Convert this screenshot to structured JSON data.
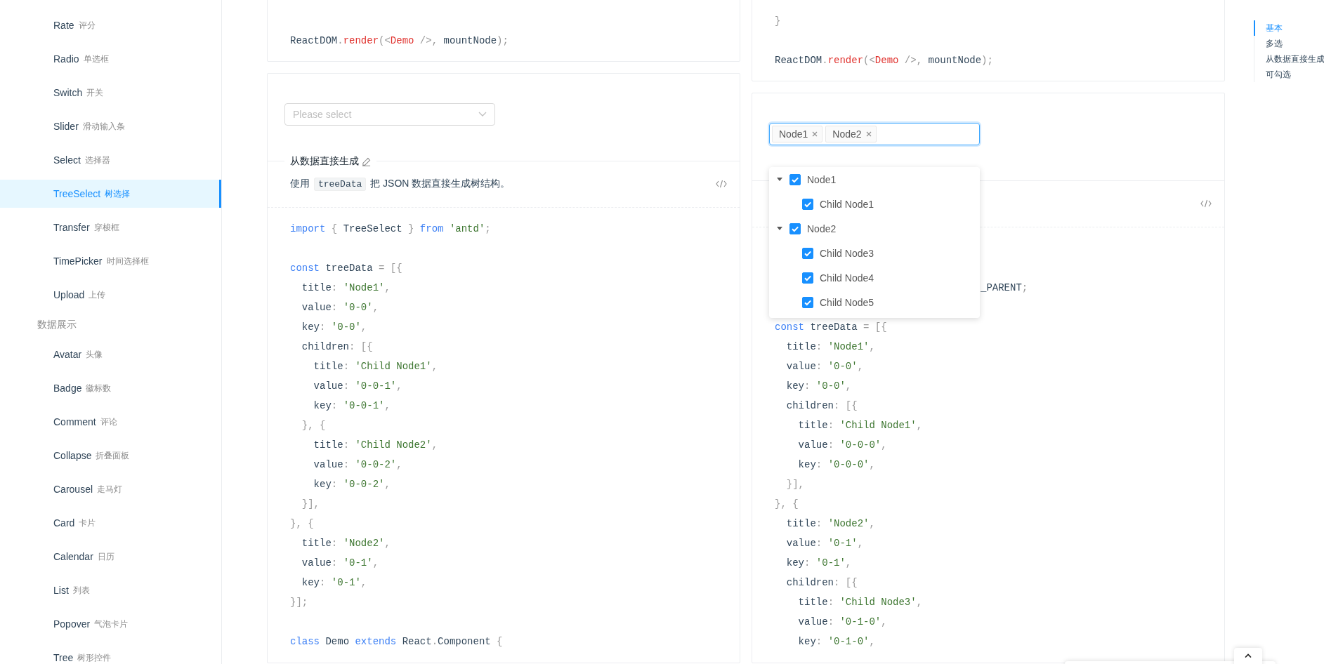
{
  "sidebar": {
    "items": [
      {
        "kind": "item",
        "label": "Rate",
        "sublabel": "评分",
        "selected": false
      },
      {
        "kind": "item",
        "label": "Radio",
        "sublabel": "单选框",
        "selected": false
      },
      {
        "kind": "item",
        "label": "Switch",
        "sublabel": "开关",
        "selected": false
      },
      {
        "kind": "item",
        "label": "Slider",
        "sublabel": "滑动输入条",
        "selected": false
      },
      {
        "kind": "item",
        "label": "Select",
        "sublabel": "选择器",
        "selected": false
      },
      {
        "kind": "item",
        "label": "TreeSelect",
        "sublabel": "树选择",
        "selected": true
      },
      {
        "kind": "item",
        "label": "Transfer",
        "sublabel": "穿梭框",
        "selected": false
      },
      {
        "kind": "item",
        "label": "TimePicker",
        "sublabel": "时间选择框",
        "selected": false
      },
      {
        "kind": "item",
        "label": "Upload",
        "sublabel": "上传",
        "selected": false
      },
      {
        "kind": "group",
        "label": "数据展示"
      },
      {
        "kind": "item",
        "label": "Avatar",
        "sublabel": "头像",
        "selected": false
      },
      {
        "kind": "item",
        "label": "Badge",
        "sublabel": "徽标数",
        "selected": false
      },
      {
        "kind": "item",
        "label": "Comment",
        "sublabel": "评论",
        "selected": false
      },
      {
        "kind": "item",
        "label": "Collapse",
        "sublabel": "折叠面板",
        "selected": false
      },
      {
        "kind": "item",
        "label": "Carousel",
        "sublabel": "走马灯",
        "selected": false
      },
      {
        "kind": "item",
        "label": "Card",
        "sublabel": "卡片",
        "selected": false
      },
      {
        "kind": "item",
        "label": "Calendar",
        "sublabel": "日历",
        "selected": false
      },
      {
        "kind": "item",
        "label": "List",
        "sublabel": "列表",
        "selected": false
      },
      {
        "kind": "item",
        "label": "Popover",
        "sublabel": "气泡卡片",
        "selected": false
      },
      {
        "kind": "item",
        "label": "Tree",
        "sublabel": "树形控件",
        "selected": false
      }
    ]
  },
  "left_column": {
    "top_code": {
      "lines": [
        {
          "kind": "blank"
        },
        {
          "kind": "blank"
        },
        {
          "kind": "code",
          "tokens": [
            {
              "kind": "plain",
              "text": "ReactDOM"
            },
            {
              "kind": "punct",
              "text": "."
            },
            {
              "kind": "func",
              "text": "render"
            },
            {
              "kind": "punct",
              "text": "(<"
            },
            {
              "kind": "func",
              "text": "Demo"
            },
            {
              "kind": "punct",
              "text": " />, "
            },
            {
              "kind": "plain",
              "text": "mountNode"
            },
            {
              "kind": "punct",
              "text": ");"
            }
          ]
        }
      ]
    },
    "demo": {
      "select": {
        "placeholder": "Please select"
      },
      "title": "从数据直接生成",
      "description": {
        "before": "使用",
        "code": "treeData",
        "after": "把 JSON 数据直接生成树结构。"
      },
      "code": {
        "lines": [
          {
            "kind": "code",
            "tokens": [
              {
                "kind": "keyword",
                "text": "import "
              },
              {
                "kind": "punct",
                "text": "{ "
              },
              {
                "kind": "plain",
                "text": "TreeSelect "
              },
              {
                "kind": "punct",
                "text": "} "
              },
              {
                "kind": "keyword",
                "text": "from "
              },
              {
                "kind": "string",
                "text": "'antd'"
              },
              {
                "kind": "punct",
                "text": ";"
              }
            ]
          },
          {
            "kind": "blank"
          },
          {
            "kind": "code",
            "tokens": [
              {
                "kind": "keyword",
                "text": "const "
              },
              {
                "kind": "plain",
                "text": "treeData "
              },
              {
                "kind": "punct",
                "text": "= [{"
              }
            ]
          },
          {
            "kind": "code",
            "tokens": [
              {
                "kind": "plain",
                "text": "  title"
              },
              {
                "kind": "punct",
                "text": ": "
              },
              {
                "kind": "string",
                "text": "'Node1'"
              },
              {
                "kind": "punct",
                "text": ","
              }
            ]
          },
          {
            "kind": "code",
            "tokens": [
              {
                "kind": "plain",
                "text": "  value"
              },
              {
                "kind": "punct",
                "text": ": "
              },
              {
                "kind": "string",
                "text": "'0-0'"
              },
              {
                "kind": "punct",
                "text": ","
              }
            ]
          },
          {
            "kind": "code",
            "tokens": [
              {
                "kind": "plain",
                "text": "  key"
              },
              {
                "kind": "punct",
                "text": ": "
              },
              {
                "kind": "string",
                "text": "'0-0'"
              },
              {
                "kind": "punct",
                "text": ","
              }
            ]
          },
          {
            "kind": "code",
            "tokens": [
              {
                "kind": "plain",
                "text": "  children"
              },
              {
                "kind": "punct",
                "text": ": [{"
              }
            ]
          },
          {
            "kind": "code",
            "tokens": [
              {
                "kind": "plain",
                "text": "    title"
              },
              {
                "kind": "punct",
                "text": ": "
              },
              {
                "kind": "string",
                "text": "'Child Node1'"
              },
              {
                "kind": "punct",
                "text": ","
              }
            ]
          },
          {
            "kind": "code",
            "tokens": [
              {
                "kind": "plain",
                "text": "    value"
              },
              {
                "kind": "punct",
                "text": ": "
              },
              {
                "kind": "string",
                "text": "'0-0-1'"
              },
              {
                "kind": "punct",
                "text": ","
              }
            ]
          },
          {
            "kind": "code",
            "tokens": [
              {
                "kind": "plain",
                "text": "    key"
              },
              {
                "kind": "punct",
                "text": ": "
              },
              {
                "kind": "string",
                "text": "'0-0-1'"
              },
              {
                "kind": "punct",
                "text": ","
              }
            ]
          },
          {
            "kind": "code",
            "tokens": [
              {
                "kind": "punct",
                "text": "  }, {"
              }
            ]
          },
          {
            "kind": "code",
            "tokens": [
              {
                "kind": "plain",
                "text": "    title"
              },
              {
                "kind": "punct",
                "text": ": "
              },
              {
                "kind": "string",
                "text": "'Child Node2'"
              },
              {
                "kind": "punct",
                "text": ","
              }
            ]
          },
          {
            "kind": "code",
            "tokens": [
              {
                "kind": "plain",
                "text": "    value"
              },
              {
                "kind": "punct",
                "text": ": "
              },
              {
                "kind": "string",
                "text": "'0-0-2'"
              },
              {
                "kind": "punct",
                "text": ","
              }
            ]
          },
          {
            "kind": "code",
            "tokens": [
              {
                "kind": "plain",
                "text": "    key"
              },
              {
                "kind": "punct",
                "text": ": "
              },
              {
                "kind": "string",
                "text": "'0-0-2'"
              },
              {
                "kind": "punct",
                "text": ","
              }
            ]
          },
          {
            "kind": "code",
            "tokens": [
              {
                "kind": "punct",
                "text": "  }],"
              }
            ]
          },
          {
            "kind": "code",
            "tokens": [
              {
                "kind": "punct",
                "text": "}, {"
              }
            ]
          },
          {
            "kind": "code",
            "tokens": [
              {
                "kind": "plain",
                "text": "  title"
              },
              {
                "kind": "punct",
                "text": ": "
              },
              {
                "kind": "string",
                "text": "'Node2'"
              },
              {
                "kind": "punct",
                "text": ","
              }
            ]
          },
          {
            "kind": "code",
            "tokens": [
              {
                "kind": "plain",
                "text": "  value"
              },
              {
                "kind": "punct",
                "text": ": "
              },
              {
                "kind": "string",
                "text": "'0-1'"
              },
              {
                "kind": "punct",
                "text": ","
              }
            ]
          },
          {
            "kind": "code",
            "tokens": [
              {
                "kind": "plain",
                "text": "  key"
              },
              {
                "kind": "punct",
                "text": ": "
              },
              {
                "kind": "string",
                "text": "'0-1'"
              },
              {
                "kind": "punct",
                "text": ","
              }
            ]
          },
          {
            "kind": "code",
            "tokens": [
              {
                "kind": "punct",
                "text": "}];"
              }
            ]
          },
          {
            "kind": "blank"
          },
          {
            "kind": "code",
            "tokens": [
              {
                "kind": "keyword",
                "text": "class "
              },
              {
                "kind": "plain",
                "text": "Demo "
              },
              {
                "kind": "keyword",
                "text": "extends "
              },
              {
                "kind": "plain",
                "text": "React"
              },
              {
                "kind": "punct",
                "text": "."
              },
              {
                "kind": "plain",
                "text": "Component "
              },
              {
                "kind": "punct",
                "text": "{"
              }
            ]
          }
        ]
      }
    }
  },
  "right_column": {
    "top_code": {
      "lines": [
        {
          "kind": "blank"
        },
        {
          "kind": "code",
          "tokens": [
            {
              "kind": "punct",
              "text": "}"
            }
          ]
        },
        {
          "kind": "blank"
        },
        {
          "kind": "code",
          "tokens": [
            {
              "kind": "plain",
              "text": "ReactDOM"
            },
            {
              "kind": "punct",
              "text": "."
            },
            {
              "kind": "func",
              "text": "render"
            },
            {
              "kind": "punct",
              "text": "(<"
            },
            {
              "kind": "func",
              "text": "Demo"
            },
            {
              "kind": "punct",
              "text": " />, "
            },
            {
              "kind": "plain",
              "text": "mountNode"
            },
            {
              "kind": "punct",
              "text": ");"
            }
          ]
        }
      ]
    },
    "demo": {
      "tags": [
        {
          "label": "Node1"
        },
        {
          "label": "Node2"
        }
      ],
      "tree": {
        "nodes": [
          {
            "label": "Node1",
            "checked": true,
            "expanded": true,
            "children": [
              {
                "label": "Child Node1",
                "checked": true
              }
            ]
          },
          {
            "label": "Node2",
            "checked": true,
            "expanded": true,
            "children": [
              {
                "label": "Child Node3",
                "checked": true
              },
              {
                "label": "Child Node4",
                "checked": true
              },
              {
                "label": "Child Node5",
                "checked": true
              }
            ]
          }
        ]
      },
      "code": {
        "lines": [
          {
            "kind": "code",
            "tokens": [
              {
                "kind": "plain",
                "text": "_PARENT"
              },
              {
                "kind": "punct",
                "text": ";"
              }
            ]
          },
          {
            "kind": "blank"
          },
          {
            "kind": "code",
            "tokens": [
              {
                "kind": "keyword",
                "text": "const "
              },
              {
                "kind": "plain",
                "text": "treeData "
              },
              {
                "kind": "punct",
                "text": "= [{"
              }
            ]
          },
          {
            "kind": "code",
            "tokens": [
              {
                "kind": "plain",
                "text": "  title"
              },
              {
                "kind": "punct",
                "text": ": "
              },
              {
                "kind": "string",
                "text": "'Node1'"
              },
              {
                "kind": "punct",
                "text": ","
              }
            ]
          },
          {
            "kind": "code",
            "tokens": [
              {
                "kind": "plain",
                "text": "  value"
              },
              {
                "kind": "punct",
                "text": ": "
              },
              {
                "kind": "string",
                "text": "'0-0'"
              },
              {
                "kind": "punct",
                "text": ","
              }
            ]
          },
          {
            "kind": "code",
            "tokens": [
              {
                "kind": "plain",
                "text": "  key"
              },
              {
                "kind": "punct",
                "text": ": "
              },
              {
                "kind": "string",
                "text": "'0-0'"
              },
              {
                "kind": "punct",
                "text": ","
              }
            ]
          },
          {
            "kind": "code",
            "tokens": [
              {
                "kind": "plain",
                "text": "  children"
              },
              {
                "kind": "punct",
                "text": ": [{"
              }
            ]
          },
          {
            "kind": "code",
            "tokens": [
              {
                "kind": "plain",
                "text": "    title"
              },
              {
                "kind": "punct",
                "text": ": "
              },
              {
                "kind": "string",
                "text": "'Child Node1'"
              },
              {
                "kind": "punct",
                "text": ","
              }
            ]
          },
          {
            "kind": "code",
            "tokens": [
              {
                "kind": "plain",
                "text": "    value"
              },
              {
                "kind": "punct",
                "text": ": "
              },
              {
                "kind": "string",
                "text": "'0-0-0'"
              },
              {
                "kind": "punct",
                "text": ","
              }
            ]
          },
          {
            "kind": "code",
            "tokens": [
              {
                "kind": "plain",
                "text": "    key"
              },
              {
                "kind": "punct",
                "text": ": "
              },
              {
                "kind": "string",
                "text": "'0-0-0'"
              },
              {
                "kind": "punct",
                "text": ","
              }
            ]
          },
          {
            "kind": "code",
            "tokens": [
              {
                "kind": "punct",
                "text": "  }],"
              }
            ]
          },
          {
            "kind": "code",
            "tokens": [
              {
                "kind": "punct",
                "text": "}, {"
              }
            ]
          },
          {
            "kind": "code",
            "tokens": [
              {
                "kind": "plain",
                "text": "  title"
              },
              {
                "kind": "punct",
                "text": ": "
              },
              {
                "kind": "string",
                "text": "'Node2'"
              },
              {
                "kind": "punct",
                "text": ","
              }
            ]
          },
          {
            "kind": "code",
            "tokens": [
              {
                "kind": "plain",
                "text": "  value"
              },
              {
                "kind": "punct",
                "text": ": "
              },
              {
                "kind": "string",
                "text": "'0-1'"
              },
              {
                "kind": "punct",
                "text": ","
              }
            ]
          },
          {
            "kind": "code",
            "tokens": [
              {
                "kind": "plain",
                "text": "  key"
              },
              {
                "kind": "punct",
                "text": ": "
              },
              {
                "kind": "string",
                "text": "'0-1'"
              },
              {
                "kind": "punct",
                "text": ","
              }
            ]
          },
          {
            "kind": "code",
            "tokens": [
              {
                "kind": "plain",
                "text": "  children"
              },
              {
                "kind": "punct",
                "text": ": [{"
              }
            ]
          },
          {
            "kind": "code",
            "tokens": [
              {
                "kind": "plain",
                "text": "    title"
              },
              {
                "kind": "punct",
                "text": ": "
              },
              {
                "kind": "string",
                "text": "'Child Node3'"
              },
              {
                "kind": "punct",
                "text": ","
              }
            ]
          },
          {
            "kind": "code",
            "tokens": [
              {
                "kind": "plain",
                "text": "    value"
              },
              {
                "kind": "punct",
                "text": ": "
              },
              {
                "kind": "string",
                "text": "'0-1-0'"
              },
              {
                "kind": "punct",
                "text": ","
              }
            ]
          },
          {
            "kind": "code",
            "tokens": [
              {
                "kind": "plain",
                "text": "    key"
              },
              {
                "kind": "punct",
                "text": ": "
              },
              {
                "kind": "string",
                "text": "'0-1-0'"
              },
              {
                "kind": "punct",
                "text": ","
              }
            ]
          }
        ]
      }
    }
  },
  "anchor": {
    "items": [
      {
        "label": "基本",
        "selected": true
      },
      {
        "label": "多选",
        "selected": false
      },
      {
        "label": "从数据直接生成",
        "selected": false
      },
      {
        "label": "可勾选",
        "selected": false
      }
    ]
  }
}
